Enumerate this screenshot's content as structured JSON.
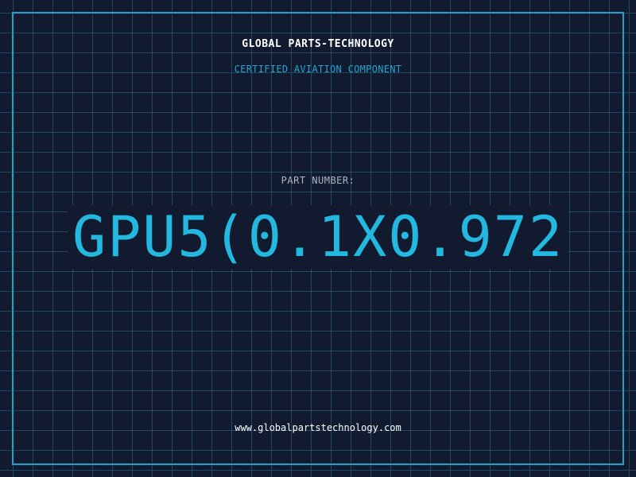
{
  "header": {
    "company": "GLOBAL PARTS-TECHNOLOGY",
    "tagline": "CERTIFIED AVIATION COMPONENT"
  },
  "part": {
    "label": "PART NUMBER:",
    "number": "GPU5(0.1X0.972"
  },
  "footer": {
    "website": "www.globalpartstechnology.com"
  },
  "colors": {
    "background": "#111a2e",
    "grid": "#286e8c",
    "accent": "#22b8e0",
    "frame": "#1ea3cc",
    "text": "#ffffff",
    "label": "#a9b5c4"
  }
}
